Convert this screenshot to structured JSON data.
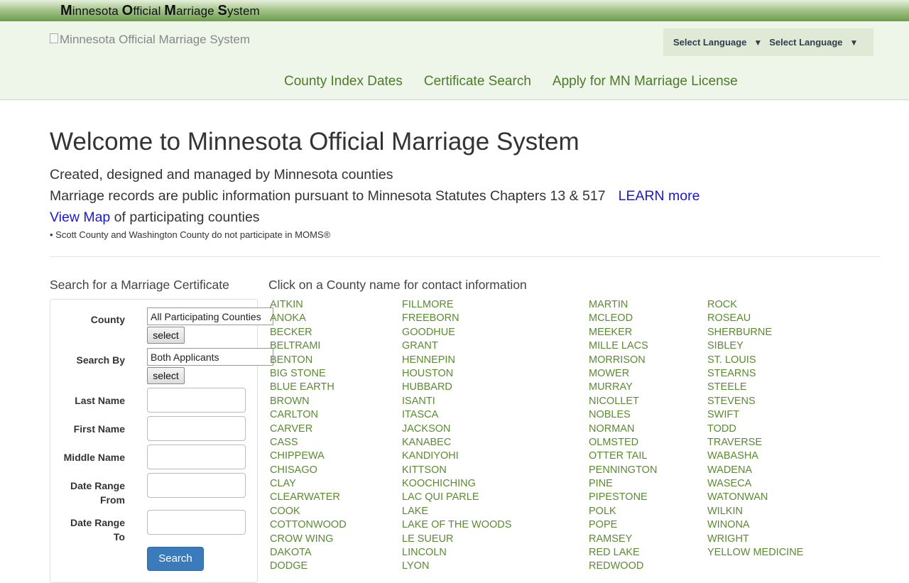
{
  "topbar": {
    "title_parts": [
      {
        "cap": "M",
        "rest": "innesota "
      },
      {
        "cap": "O",
        "rest": "fficial "
      },
      {
        "cap": "M",
        "rest": "arriage "
      },
      {
        "cap": "S",
        "rest": "ystem"
      }
    ]
  },
  "header": {
    "logo_alt": "Minnesota Official Marriage System",
    "language_selects": [
      "Select Language",
      "Select Language"
    ],
    "nav": [
      "County Index Dates",
      "Certificate Search",
      "Apply for MN Marriage License"
    ]
  },
  "intro": {
    "heading": "Welcome to Minnesota Official Marriage System",
    "line1": "Created, designed and managed by Minnesota counties",
    "line2": "Marriage records are public information pursuant to Minnesota Statutes Chapters 13 & 517",
    "learn_more": "LEARN more",
    "view_map": "View Map",
    "line3_rest": " of participating counties",
    "note": "• Scott County and Washington County do not participate in MOMS®"
  },
  "search": {
    "title": "Search for a Marriage Certificate",
    "county_label": "County",
    "county_value": "All Participating Counties",
    "select_label": "select",
    "search_by_label": "Search By",
    "search_by_value": "Both Applicants",
    "last_name_label": "Last Name",
    "first_name_label": "First Name",
    "middle_name_label": "Middle Name",
    "date_from_label_1": "Date Range",
    "date_from_label_2": "From",
    "date_to_label_1": "Date Range",
    "date_to_label_2": "To",
    "search_button": "Search"
  },
  "counties": {
    "title": "Click on a County name for contact information",
    "columns": [
      [
        "AITKIN",
        "ANOKA",
        "BECKER",
        "BELTRAMI",
        "BENTON",
        "BIG STONE",
        "BLUE EARTH",
        "BROWN",
        "CARLTON",
        "CARVER",
        "CASS",
        "CHIPPEWA",
        "CHISAGO",
        "CLAY",
        "CLEARWATER",
        "COOK",
        "COTTONWOOD",
        "CROW WING",
        "DAKOTA",
        "DODGE"
      ],
      [
        "FILLMORE",
        "FREEBORN",
        "GOODHUE",
        "GRANT",
        "HENNEPIN",
        "HOUSTON",
        "HUBBARD",
        "ISANTI",
        "ITASCA",
        "JACKSON",
        "KANABEC",
        "KANDIYOHI",
        "KITTSON",
        "KOOCHICHING",
        "LAC QUI PARLE",
        "LAKE",
        "LAKE OF THE WOODS",
        "LE SUEUR",
        "LINCOLN",
        "LYON"
      ],
      [
        "MARTIN",
        "MCLEOD",
        "MEEKER",
        "MILLE LACS",
        "MORRISON",
        "MOWER",
        "MURRAY",
        "NICOLLET",
        "NOBLES",
        "NORMAN",
        "OLMSTED",
        "OTTER TAIL",
        "PENNINGTON",
        "PINE",
        "PIPESTONE",
        "POLK",
        "POPE",
        "RAMSEY",
        "RED LAKE",
        "REDWOOD"
      ],
      [
        "ROCK",
        "ROSEAU",
        "SHERBURNE",
        "SIBLEY",
        "ST. LOUIS",
        "STEARNS",
        "STEELE",
        "STEVENS",
        "SWIFT",
        "TODD",
        "TRAVERSE",
        "WABASHA",
        "WADENA",
        "WASECA",
        "WATONWAN",
        "WILKIN",
        "WINONA",
        "WRIGHT",
        "YELLOW MEDICINE"
      ]
    ]
  }
}
